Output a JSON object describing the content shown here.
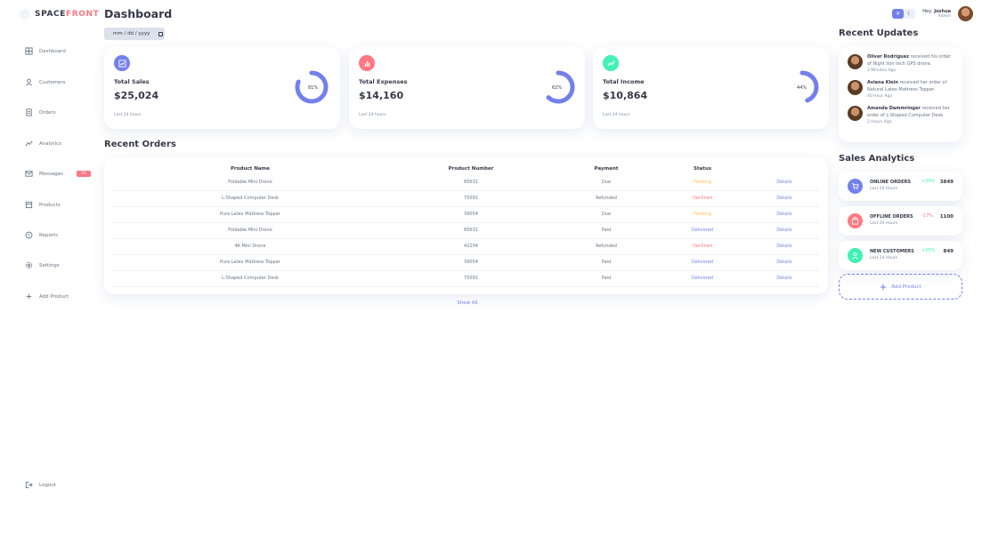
{
  "brand": {
    "name_part1": "SPACE",
    "name_part2": "FRONT"
  },
  "header": {
    "title": "Dashboard",
    "date_placeholder": "mm / dd / yyyy"
  },
  "sidebar": {
    "items": [
      {
        "label": "Dashboard",
        "icon": "grid-icon"
      },
      {
        "label": "Customers",
        "icon": "person-icon"
      },
      {
        "label": "Orders",
        "icon": "receipt-icon"
      },
      {
        "label": "Analytics",
        "icon": "chart-line-icon"
      },
      {
        "label": "Messages",
        "icon": "mail-icon",
        "badge": "26"
      },
      {
        "label": "Products",
        "icon": "inventory-icon"
      },
      {
        "label": "Reports",
        "icon": "report-icon"
      },
      {
        "label": "Settings",
        "icon": "gear-icon"
      },
      {
        "label": "Add Product",
        "icon": "plus-icon"
      }
    ],
    "logout_label": "Logout"
  },
  "cards": [
    {
      "label": "Total Sales",
      "value": "$25,024",
      "footer": "Last 24 hours",
      "percent": "81%",
      "fill": 0.81,
      "icon_color": "#7380ec"
    },
    {
      "label": "Total Expenses",
      "value": "$14,160",
      "footer": "Last 24 hours",
      "percent": "62%",
      "fill": 0.62,
      "icon_color": "#ff7782"
    },
    {
      "label": "Total Income",
      "value": "$10,864",
      "footer": "Last 24 hours",
      "percent": "44%",
      "fill": 0.44,
      "icon_color": "#41f1b6"
    }
  ],
  "recent_orders": {
    "title": "Recent Orders",
    "columns": [
      "Product Name",
      "Product Number",
      "Payment",
      "Status"
    ],
    "rows": [
      {
        "name": "Foldable Mini Drone",
        "number": "85631",
        "payment": "Due",
        "status": "Pending",
        "details": "Details"
      },
      {
        "name": "L-Shaped Computer Desk",
        "number": "75091",
        "payment": "Refunded",
        "status": "Declined",
        "details": "Details"
      },
      {
        "name": "Pure Latex Mattress Topper",
        "number": "39054",
        "payment": "Due",
        "status": "Pending",
        "details": "Details"
      },
      {
        "name": "Foldable Mini Drone",
        "number": "85631",
        "payment": "Paid",
        "status": "Delivered",
        "details": "Details"
      },
      {
        "name": "4K Mini Drone",
        "number": "42104",
        "payment": "Refunded",
        "status": "Declined",
        "details": "Details"
      },
      {
        "name": "Pure Latex Mattress Topper",
        "number": "39054",
        "payment": "Paid",
        "status": "Delivered",
        "details": "Details"
      },
      {
        "name": "L-Shaped Computer Desk",
        "number": "75091",
        "payment": "Paid",
        "status": "Delivered",
        "details": "Details"
      }
    ],
    "show_all": "Show All"
  },
  "status_colors": {
    "Pending": "#ffbb55",
    "Declined": "#ff7782",
    "Delivered": "#7380ec"
  },
  "profile": {
    "greeting": "Hey,",
    "name": "Joshua",
    "role": "Admin"
  },
  "recent_updates": {
    "title": "Recent Updates",
    "items": [
      {
        "name": "Oliver Rodriguez",
        "text": "received his order of Night lion tech GPS drone.",
        "ago": "2 Minutes Ago"
      },
      {
        "name": "Aviana Klein",
        "text": "received her order of Natural Latex Mattress Topper.",
        "ago": "40 Hour Ago"
      },
      {
        "name": "Amanda Dammringer",
        "text": "received her order of L-Shaped Computer Desk.",
        "ago": "2 Hours Ago"
      }
    ]
  },
  "sales_analytics": {
    "title": "Sales Analytics",
    "items": [
      {
        "name": "ONLINE ORDERS",
        "sub": "Last 24 Hours",
        "change": "+39%",
        "value": "3849",
        "change_color": "#41f1b6",
        "icon_color": "#7380ec"
      },
      {
        "name": "OFFLINE ORDERS",
        "sub": "Last 24 Hours",
        "change": "-17%",
        "value": "1100",
        "change_color": "#ff7782",
        "icon_color": "#ff7782"
      },
      {
        "name": "NEW CUSTOMERS",
        "sub": "Last 24 Hours",
        "change": "+25%",
        "value": "849",
        "change_color": "#41f1b6",
        "icon_color": "#41f1b6"
      }
    ],
    "add_product": "Add Product"
  }
}
